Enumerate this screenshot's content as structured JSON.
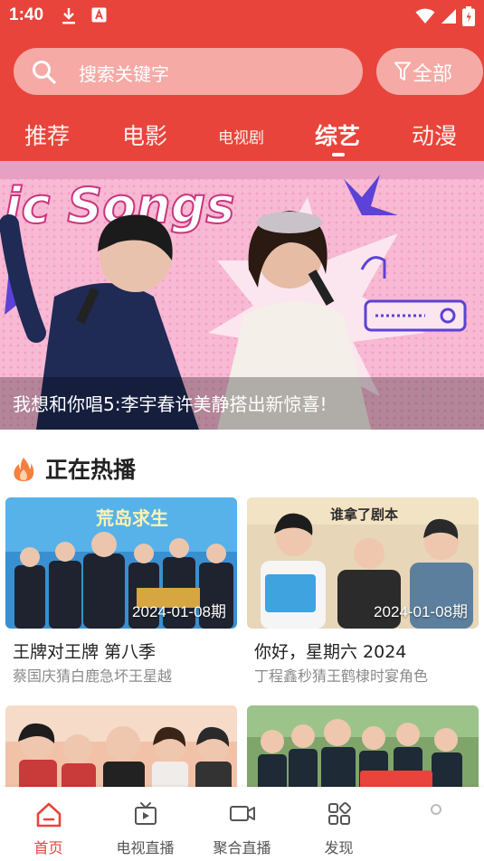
{
  "status_bar": {
    "time": "1:40"
  },
  "search": {
    "placeholder": "搜索关键字",
    "filter_label": "全部"
  },
  "tabs": [
    {
      "label": "推荐"
    },
    {
      "label": "电影"
    },
    {
      "label": "电视剧"
    },
    {
      "label": "综艺",
      "active": true
    },
    {
      "label": "动漫"
    }
  ],
  "banner": {
    "title_art": "ic Songs",
    "caption": "我想和你唱5:李宇春许美静搭出新惊喜!"
  },
  "section": {
    "title": "正在热播"
  },
  "cards": [
    {
      "title": "王牌对王牌 第八季",
      "subtitle": "蔡国庆猜白鹿急坏王星越",
      "date": "2024-01-08期",
      "art_text": "荒岛求生"
    },
    {
      "title": "你好，星期六 2024",
      "subtitle": "丁程鑫秒猜王鹤棣时宴角色",
      "date": "2024-01-08期",
      "art_text": "谁拿了剧本"
    },
    {
      "title": "",
      "subtitle": "",
      "date": "",
      "art_text": ""
    },
    {
      "title": "",
      "subtitle": "",
      "date": "",
      "art_text": ""
    }
  ],
  "bottom_nav": [
    {
      "label": "首页",
      "icon": "home-icon",
      "active": true
    },
    {
      "label": "电视直播",
      "icon": "tv-icon"
    },
    {
      "label": "聚合直播",
      "icon": "video-camera-icon"
    },
    {
      "label": "发现",
      "icon": "grid-icon"
    },
    {
      "label": "",
      "icon": "profile-icon"
    }
  ],
  "colors": {
    "accent": "#e8443b",
    "banner_pink": "#f7b5cf"
  }
}
